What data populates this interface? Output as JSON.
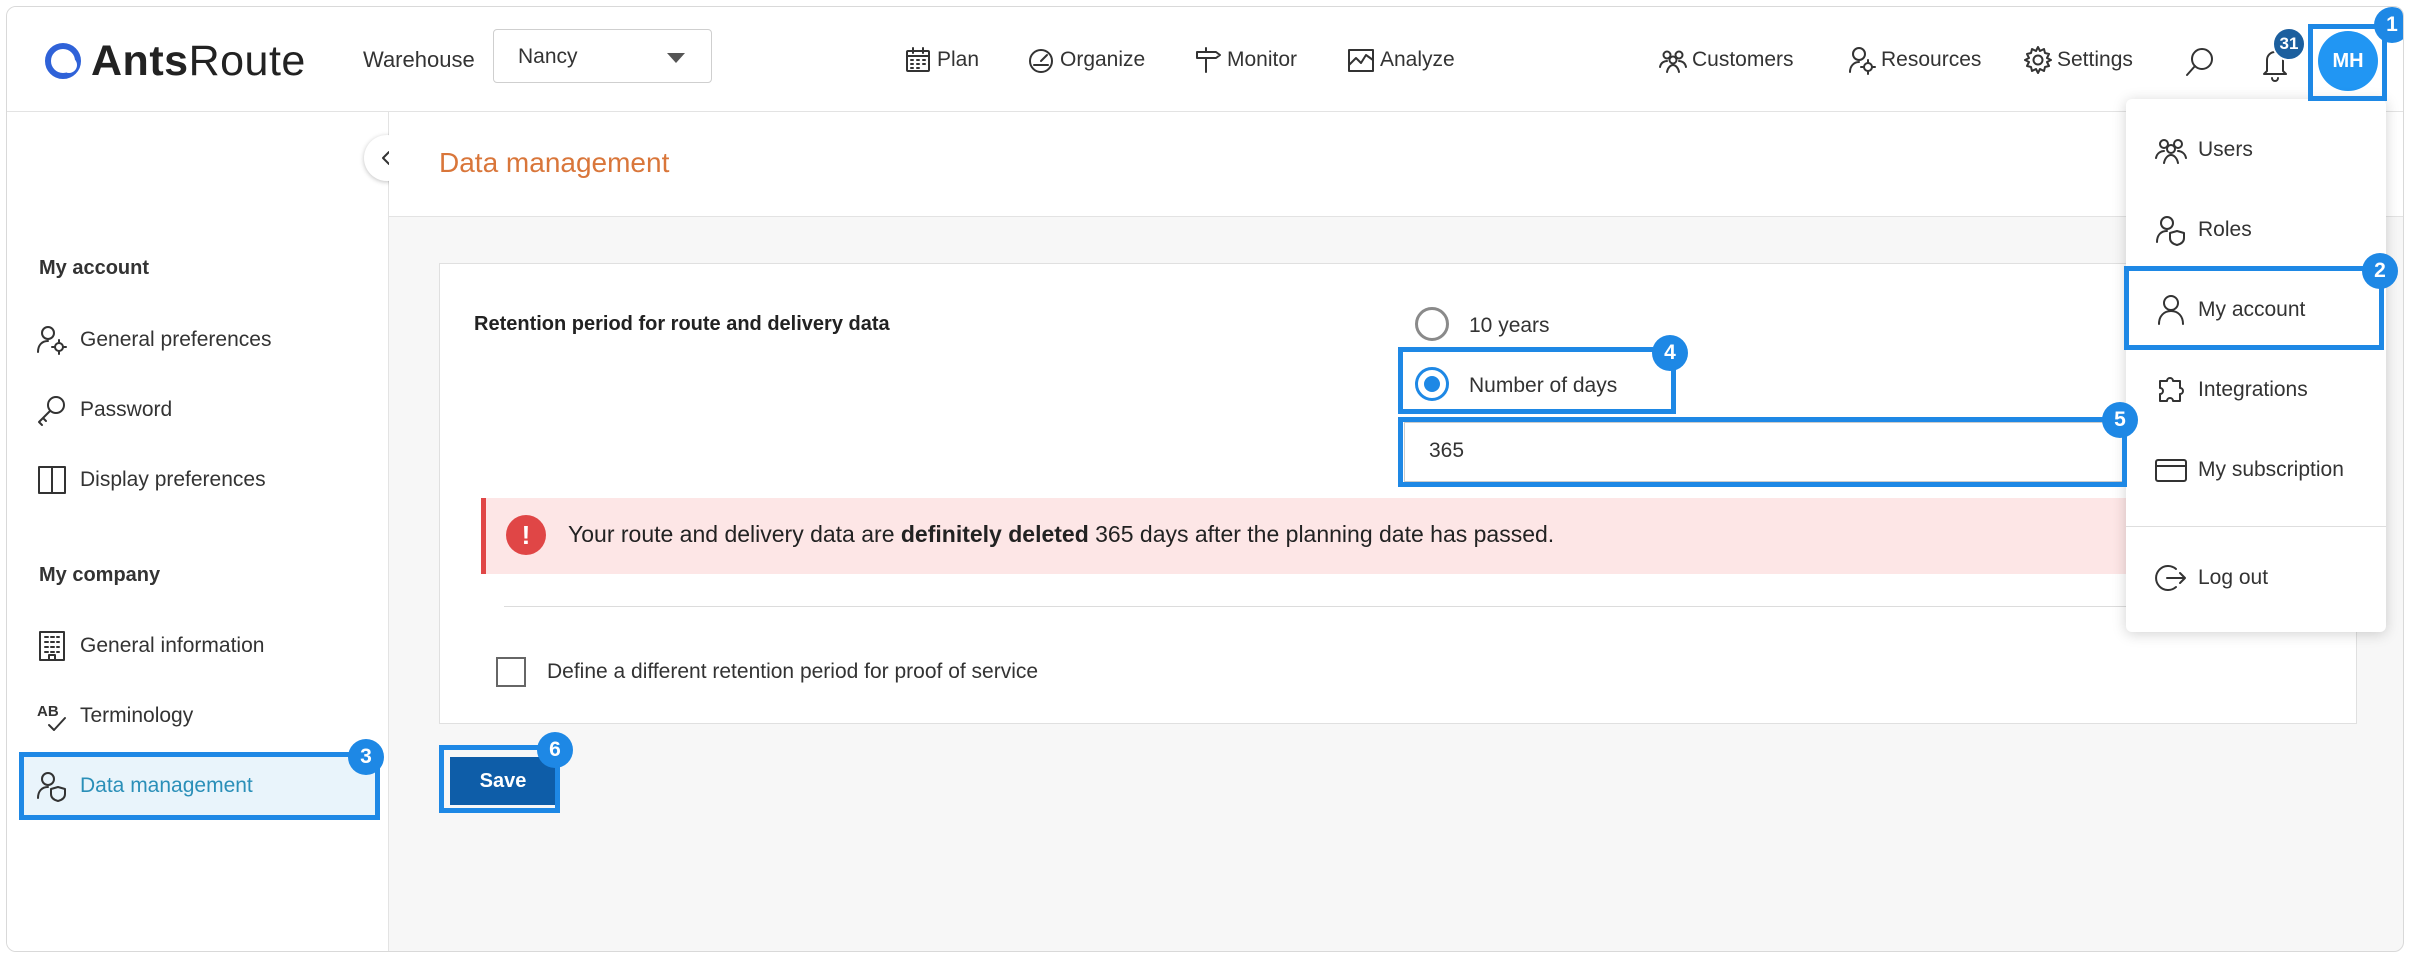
{
  "header": {
    "logo_bold": "Ants",
    "logo_thin": "Route",
    "warehouse_label": "Warehouse",
    "warehouse_value": "Nancy",
    "nav": {
      "plan": "Plan",
      "organize": "Organize",
      "monitor": "Monitor",
      "analyze": "Analyze",
      "customers": "Customers",
      "resources": "Resources",
      "settings": "Settings"
    },
    "notification_count": "31",
    "avatar_initials": "MH"
  },
  "sidebar": {
    "section_account": "My account",
    "section_company": "My company",
    "items": {
      "general_preferences": "General preferences",
      "password": "Password",
      "display_preferences": "Display preferences",
      "general_information": "General information",
      "terminology": "Terminology",
      "data_management": "Data management"
    }
  },
  "main": {
    "page_title": "Data management",
    "retention_label": "Retention period for route and delivery data",
    "option_10_years": "10 years",
    "option_days": "Number of days",
    "days_value": "365",
    "alert_prefix": "Your route and delivery data are ",
    "alert_bold": "definitely deleted",
    "alert_suffix": " 365 days after the planning date has passed.",
    "alert_icon": "!",
    "proof_checkbox_label": "Define a different retention period for proof of service",
    "save_label": "Save"
  },
  "user_menu": {
    "users": "Users",
    "roles": "Roles",
    "my_account": "My account",
    "integrations": "Integrations",
    "my_subscription": "My subscription",
    "log_out": "Log out"
  },
  "annotations": [
    "1",
    "2",
    "3",
    "4",
    "5",
    "6"
  ],
  "colors": {
    "accent": "#1e88e5",
    "title_orange": "#d9763a",
    "alert_bg": "#fde6e6",
    "alert_red": "#e04646",
    "save_blue": "#0e5da8"
  }
}
